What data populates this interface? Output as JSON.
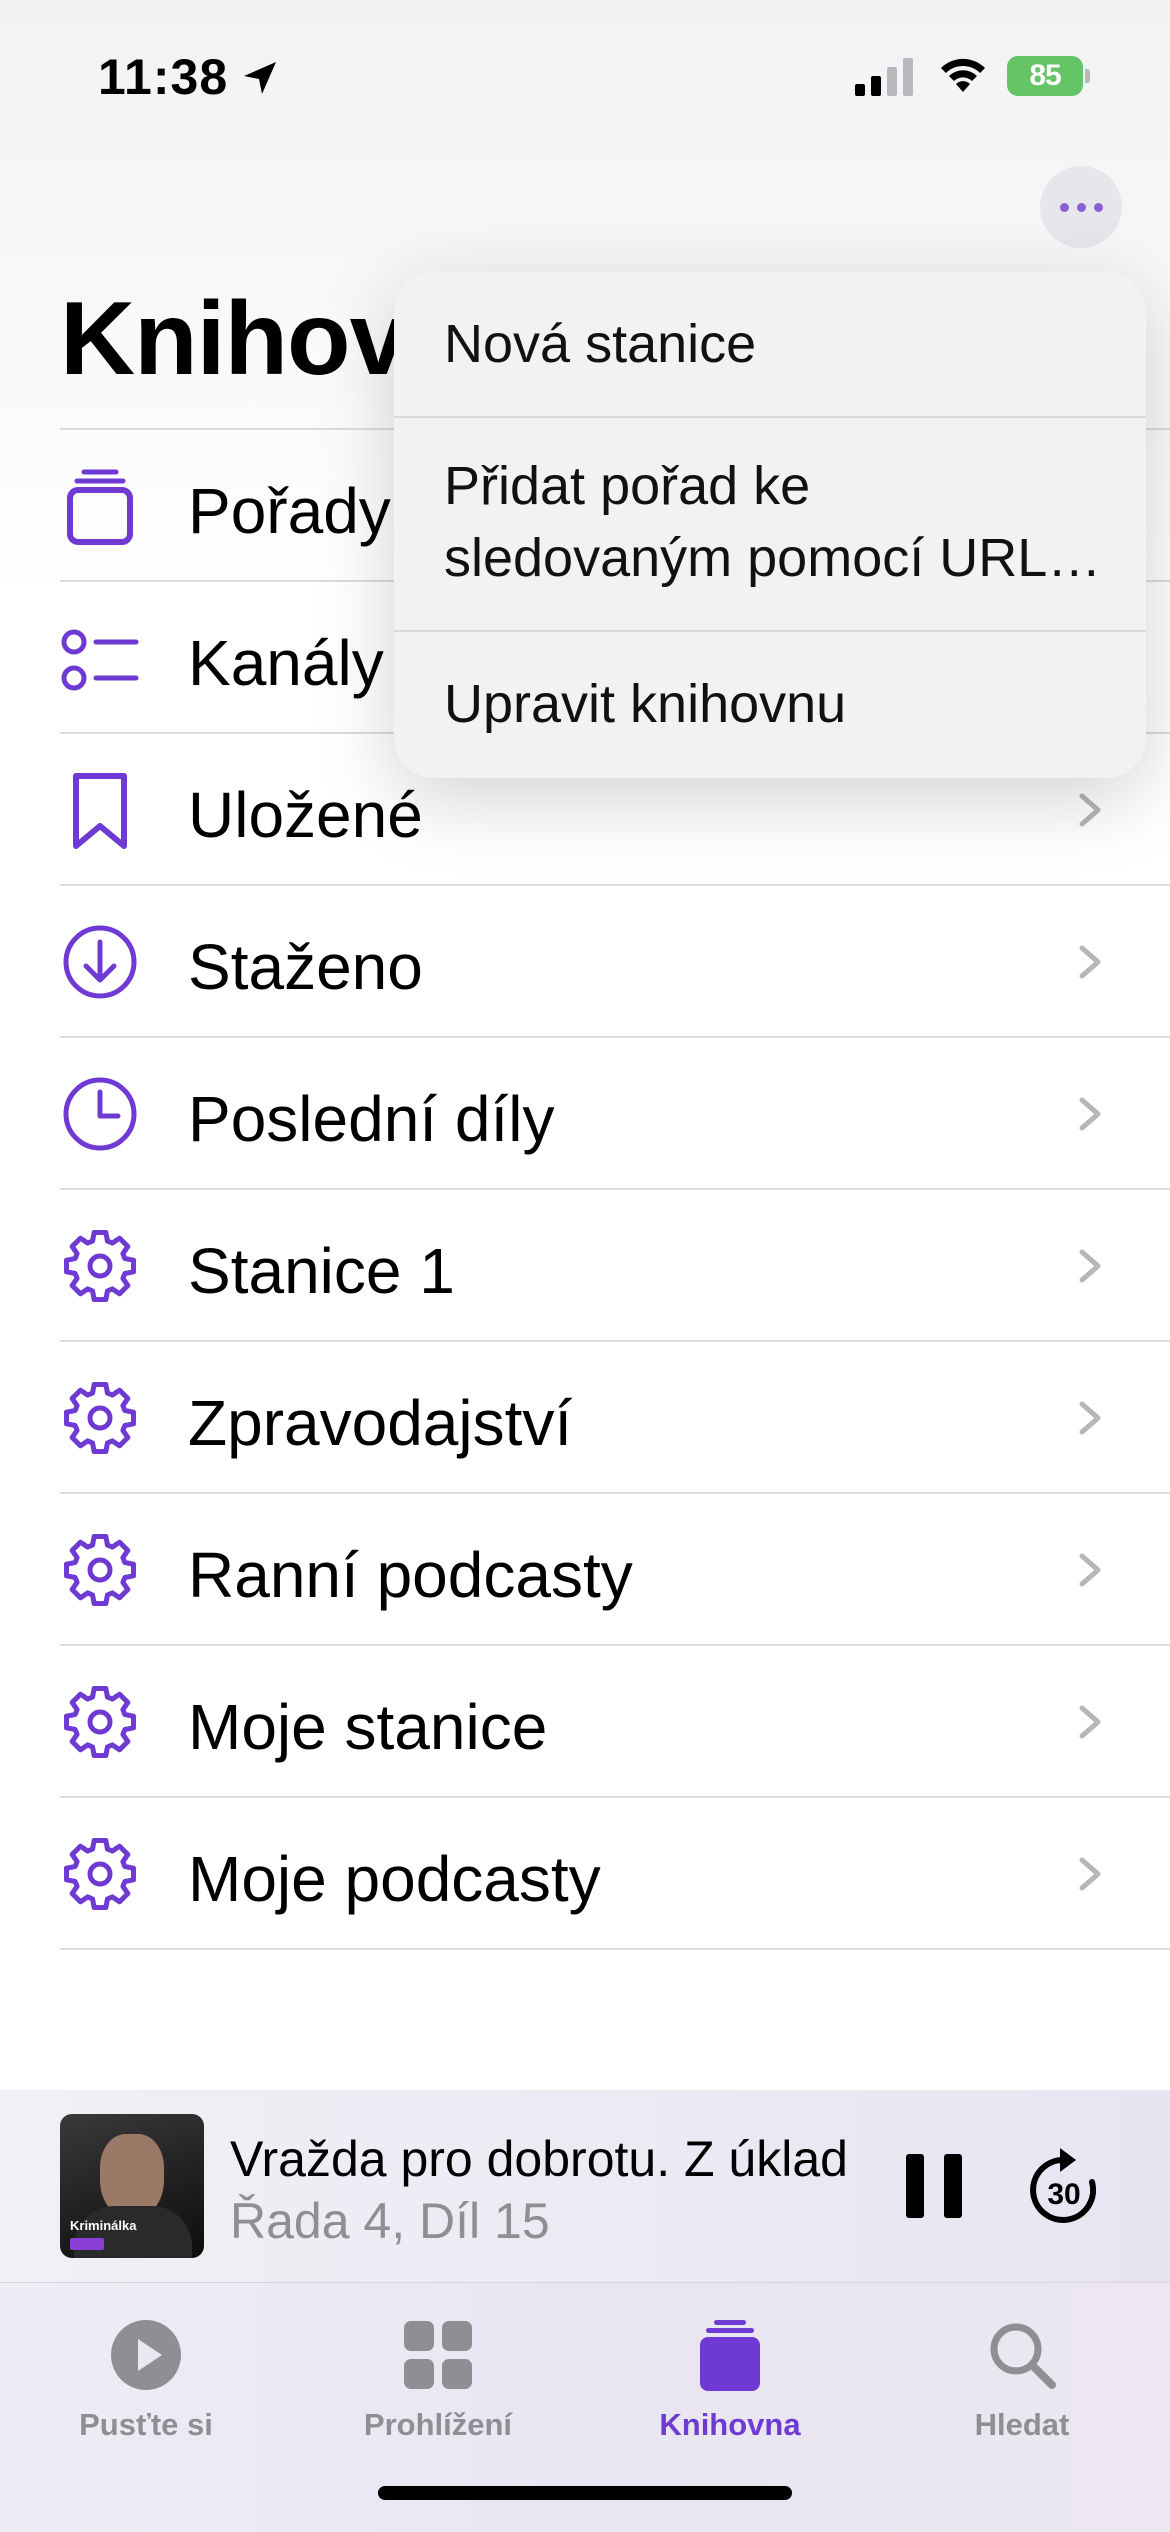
{
  "status_bar": {
    "time": "11:38",
    "battery": "85",
    "icons": [
      "location-arrow-icon",
      "cellular-signal-icon",
      "wifi-icon",
      "battery-charging-icon"
    ]
  },
  "header": {
    "title": "Knihovna",
    "more_icon": "ellipsis-icon"
  },
  "menu": {
    "items": [
      {
        "line1": "Nová stanice"
      },
      {
        "line1": "Přidat pořad ke",
        "line2": "sledovaným pomocí URL…"
      },
      {
        "line1": "Upravit knihovnu"
      }
    ]
  },
  "library": {
    "items": [
      {
        "label": "Pořady",
        "icon": "stack-icon"
      },
      {
        "label": "Kanály",
        "icon": "list-icon"
      },
      {
        "label": "Uložené",
        "icon": "bookmark-icon"
      },
      {
        "label": "Staženo",
        "icon": "download-circle-icon"
      },
      {
        "label": "Poslední díly",
        "icon": "clock-icon"
      },
      {
        "label": "Stanice 1",
        "icon": "gear-icon"
      },
      {
        "label": "Zpravodajství",
        "icon": "gear-icon"
      },
      {
        "label": "Ranní podcasty",
        "icon": "gear-icon"
      },
      {
        "label": "Moje stanice",
        "icon": "gear-icon"
      },
      {
        "label": "Moje podcasty",
        "icon": "gear-icon"
      }
    ]
  },
  "now_playing": {
    "title": "Vražda pro dobrotu. Z úklad",
    "subtitle": "Řada 4, Díl 15",
    "artwork_text": "Kriminálka",
    "skip_seconds": "30"
  },
  "tab_bar": {
    "tabs": [
      {
        "label": "Pusťte si",
        "icon": "play-circle-icon"
      },
      {
        "label": "Prohlížení",
        "icon": "grid-icon"
      },
      {
        "label": "Knihovna",
        "icon": "library-stack-icon",
        "active": true
      },
      {
        "label": "Hledat",
        "icon": "search-icon"
      }
    ]
  },
  "colors": {
    "accent": "#6f3ad4",
    "battery": "#65c466",
    "inactive": "#8e8e93"
  }
}
